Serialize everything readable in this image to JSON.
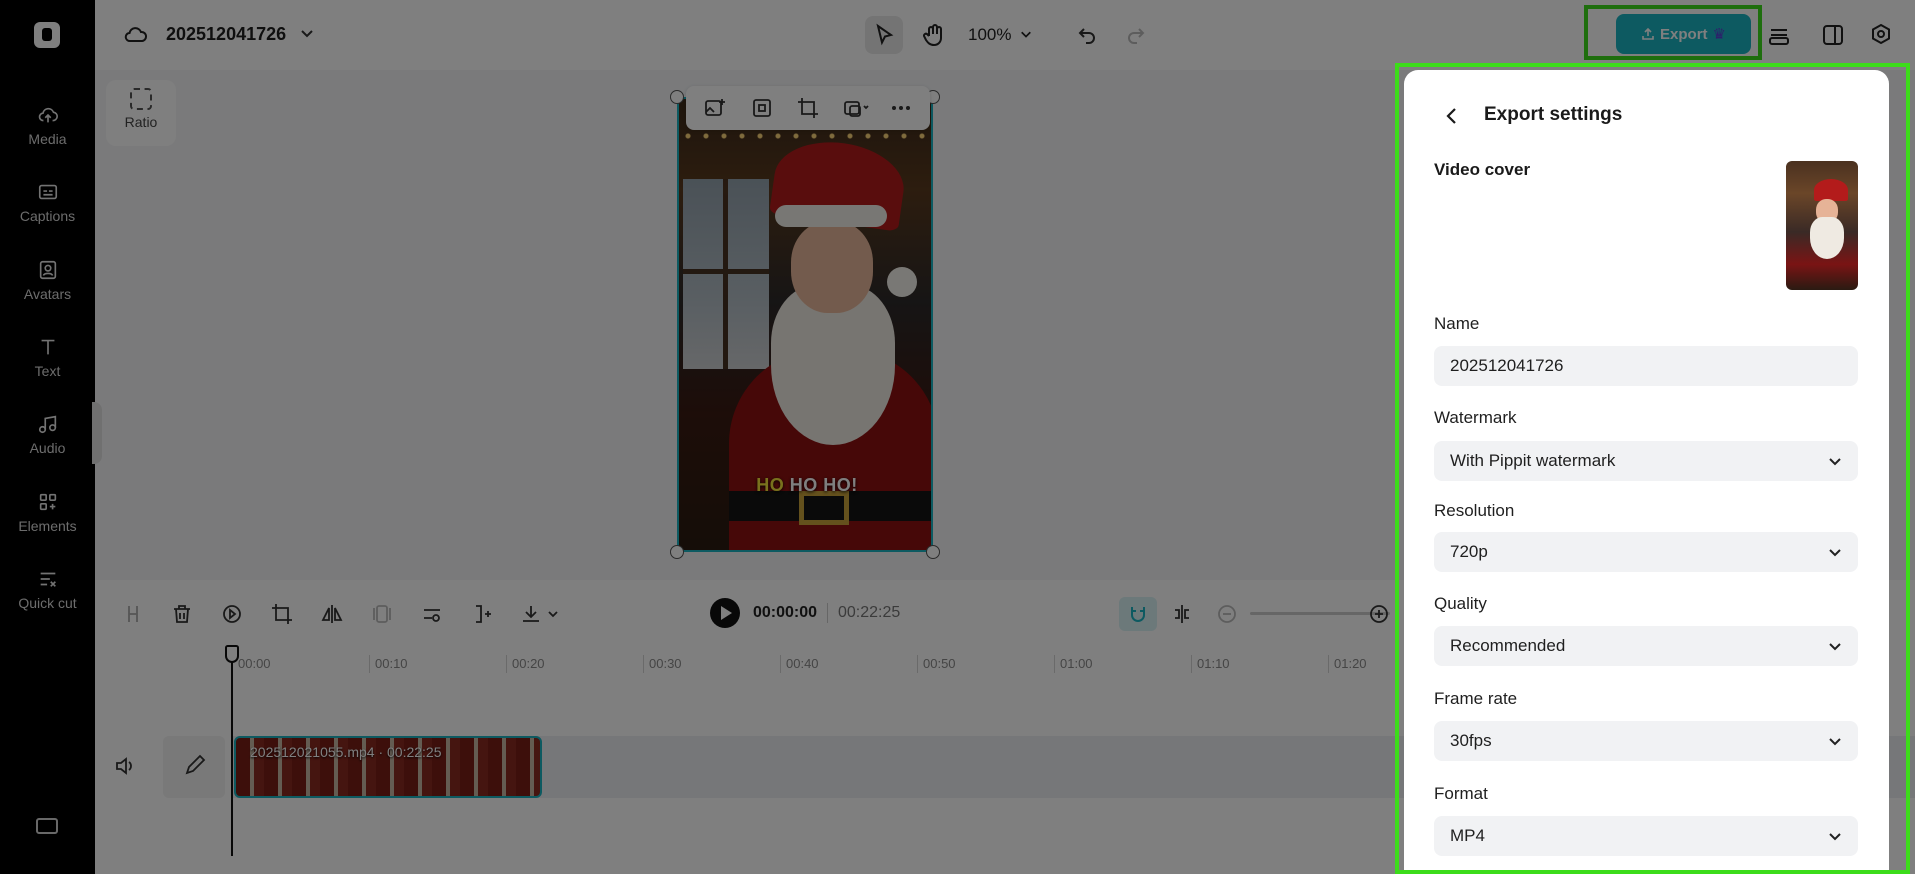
{
  "sidebar": {
    "items": [
      {
        "label": "Media",
        "icon": "cloud-upload-icon"
      },
      {
        "label": "Captions",
        "icon": "captions-icon"
      },
      {
        "label": "Avatars",
        "icon": "avatar-icon"
      },
      {
        "label": "Text",
        "icon": "text-icon"
      },
      {
        "label": "Audio",
        "icon": "music-note-icon"
      },
      {
        "label": "Elements",
        "icon": "elements-icon"
      },
      {
        "label": "Quick cut",
        "icon": "quick-cut-icon"
      }
    ]
  },
  "topbar": {
    "project_title": "202512041726",
    "zoom": "100%",
    "export_label": "Export"
  },
  "canvas": {
    "ratio_label": "Ratio",
    "subtitle_highlight": "HO",
    "subtitle_rest": " HO HO!"
  },
  "timeline": {
    "current_time": "00:00:00",
    "total_time": "00:22:25",
    "ruler": [
      "00:00",
      "00:10",
      "00:20",
      "00:30",
      "00:40",
      "00:50",
      "01:00",
      "01:10",
      "01:20"
    ],
    "clip_label": "202512021055.mp4 · 00:22:25"
  },
  "export_settings": {
    "title": "Export settings",
    "video_cover_label": "Video cover",
    "name_label": "Name",
    "name_value": "202512041726",
    "watermark_label": "Watermark",
    "watermark_value": "With Pippit watermark",
    "resolution_label": "Resolution",
    "resolution_value": "720p",
    "quality_label": "Quality",
    "quality_value": "Recommended",
    "frame_rate_label": "Frame rate",
    "frame_rate_value": "30fps",
    "format_label": "Format",
    "format_value": "MP4"
  },
  "colors": {
    "accent": "#1bb5c3",
    "highlight_box": "#3cdc1a",
    "sidebar_bg": "#000000"
  }
}
